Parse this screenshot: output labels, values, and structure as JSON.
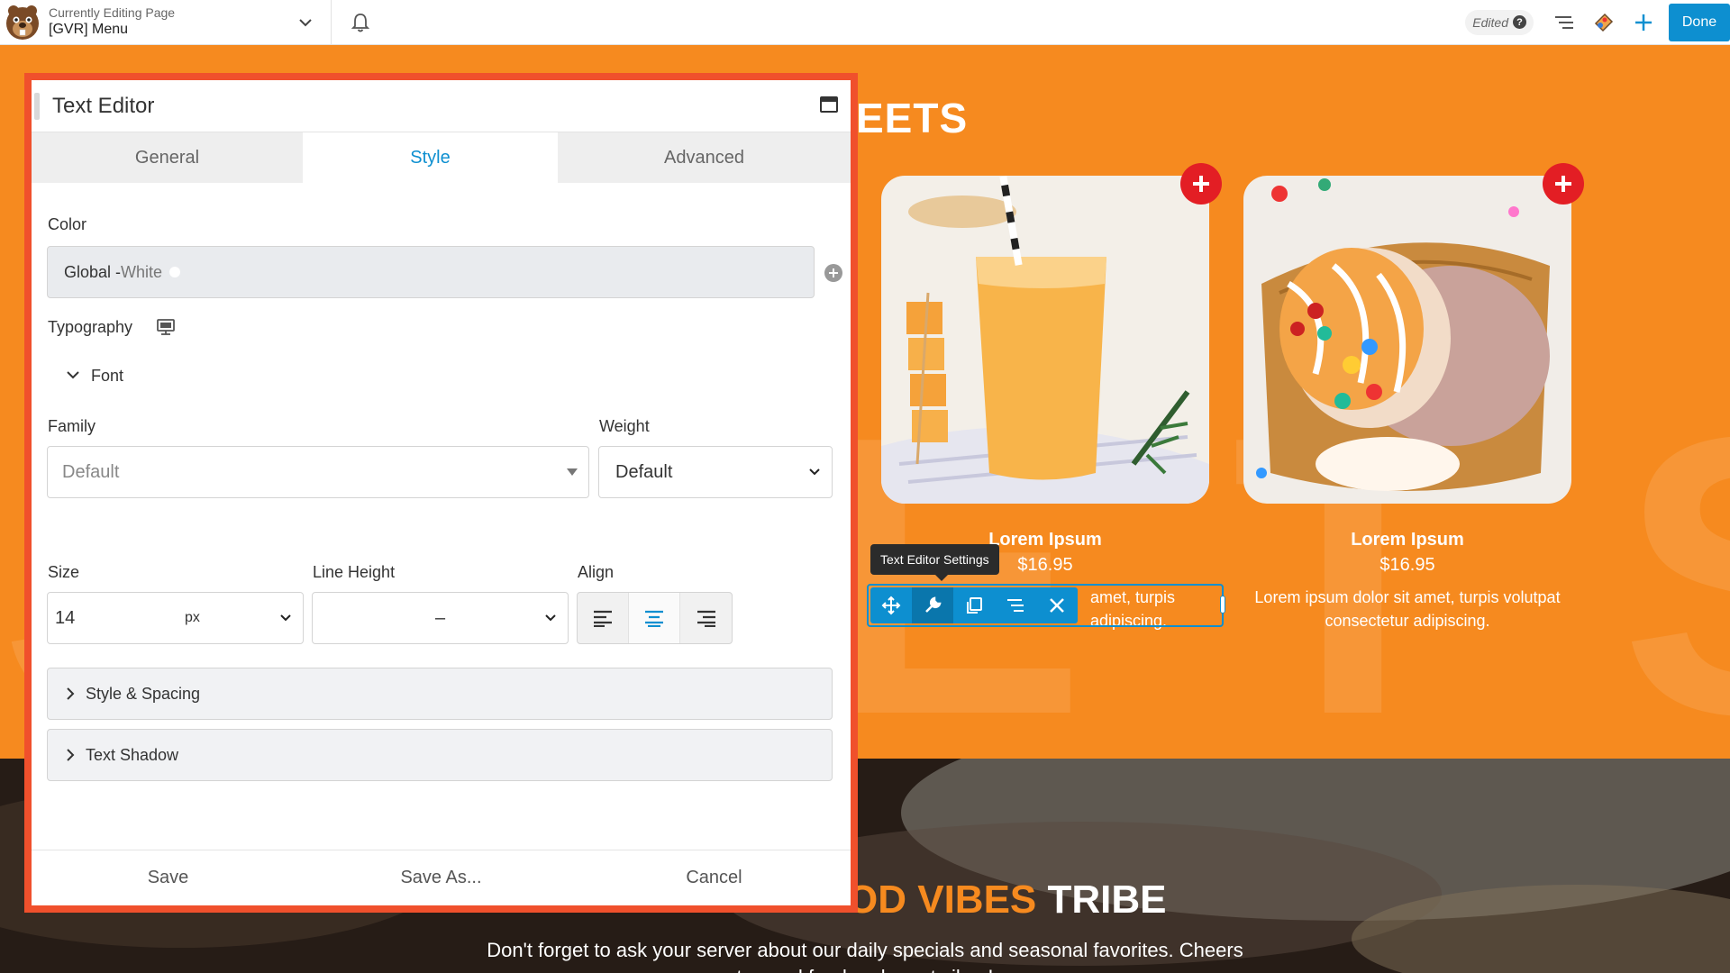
{
  "topbar": {
    "subtitle": "Currently Editing Page",
    "page_title": "[GVR] Menu",
    "status": "Edited",
    "done_label": "Done"
  },
  "page": {
    "section_heading": "EETS",
    "big_letters": "S E E T S",
    "cards": [
      {
        "name": "Lorem Ipsum",
        "price": "$16.95",
        "desc_partial_1": "amet, turpis",
        "desc_partial_2": "adipiscing."
      },
      {
        "name": "Lorem Ipsum",
        "price": "$16.95",
        "desc": "Lorem ipsum dolor sit amet, turpis volutpat consectetur adipiscing."
      }
    ],
    "tooltip": "Text Editor Settings",
    "tribe_prefix": "OD VIBES ",
    "tribe_suffix": "TRIBE",
    "tribe_text_1": "Don't forget to ask your server about our daily specials and seasonal favorites. Cheers",
    "tribe_text_2": "to good food and great vibes!"
  },
  "panel": {
    "title": "Text Editor",
    "tabs": [
      {
        "label": "General"
      },
      {
        "label": "Style"
      },
      {
        "label": "Advanced"
      }
    ],
    "color_label": "Color",
    "color_value_prefix": "Global - ",
    "color_value_name": "White",
    "typography_label": "Typography",
    "font_label": "Font",
    "family_label": "Family",
    "family_value": "Default",
    "weight_label": "Weight",
    "weight_value": "Default",
    "size_label": "Size",
    "size_value": "14",
    "size_unit": "px",
    "line_height_label": "Line Height",
    "line_height_value": "–",
    "align_label": "Align",
    "style_spacing_label": "Style & Spacing",
    "text_shadow_label": "Text Shadow",
    "footer": {
      "save": "Save",
      "save_as": "Save As...",
      "cancel": "Cancel"
    }
  },
  "colors": {
    "brand_orange": "#f68a1f",
    "panel_border": "#f0502c",
    "accent_blue": "#0d8fd0",
    "badge_red": "#e31e24"
  }
}
